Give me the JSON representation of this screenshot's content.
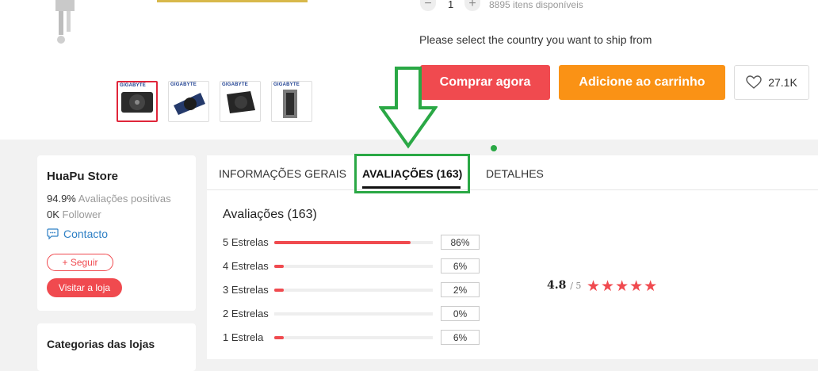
{
  "product": {
    "quantity": "1",
    "stock": "8895 itens disponíveis",
    "ship_prompt": "Please select the country you want to ship from",
    "thumbnails": [
      {
        "brand": "GIGABYTE",
        "selected": true
      },
      {
        "brand": "GIGABYTE",
        "selected": false
      },
      {
        "brand": "GIGABYTE",
        "selected": false
      },
      {
        "brand": "GIGABYTE",
        "selected": false
      }
    ],
    "buy_now_label": "Comprar agora",
    "add_to_cart_label": "Adicione ao carrinho",
    "wishlist_count": "27.1K"
  },
  "store": {
    "name": "HuaPu Store",
    "positive_value": "94.9%",
    "positive_label": "Avaliações positivas",
    "follower_value": "0K",
    "follower_label": "Follower",
    "contact_label": "Contacto",
    "follow_label": "+ Seguir",
    "visit_label": "Visitar a loja"
  },
  "categories": {
    "title": "Categorias das lojas"
  },
  "tabs": [
    {
      "label": "INFORMAÇÕES GERAIS",
      "active": false
    },
    {
      "label": "AVALIAÇÕES (163)",
      "active": true
    },
    {
      "label": "DETALHES",
      "active": false
    }
  ],
  "reviews": {
    "title": "Avaliações (163)",
    "rating": "4.8",
    "rating_max": "/ 5",
    "stars": "★★★★★",
    "distribution": [
      {
        "label": "5 Estrelas",
        "percent": "86%",
        "fraction": 0.86
      },
      {
        "label": "4 Estrelas",
        "percent": "6%",
        "fraction": 0.06
      },
      {
        "label": "3 Estrelas",
        "percent": "2%",
        "fraction": 0.02
      },
      {
        "label": "2 Estrelas",
        "percent": "0%",
        "fraction": 0.0
      },
      {
        "label": "1 Estrela",
        "percent": "6%",
        "fraction": 0.06
      }
    ]
  },
  "colors": {
    "accent_red": "#f04a4f",
    "accent_orange": "#fa9215",
    "annotation_green": "#2aa845",
    "link_blue": "#2f80c5"
  }
}
